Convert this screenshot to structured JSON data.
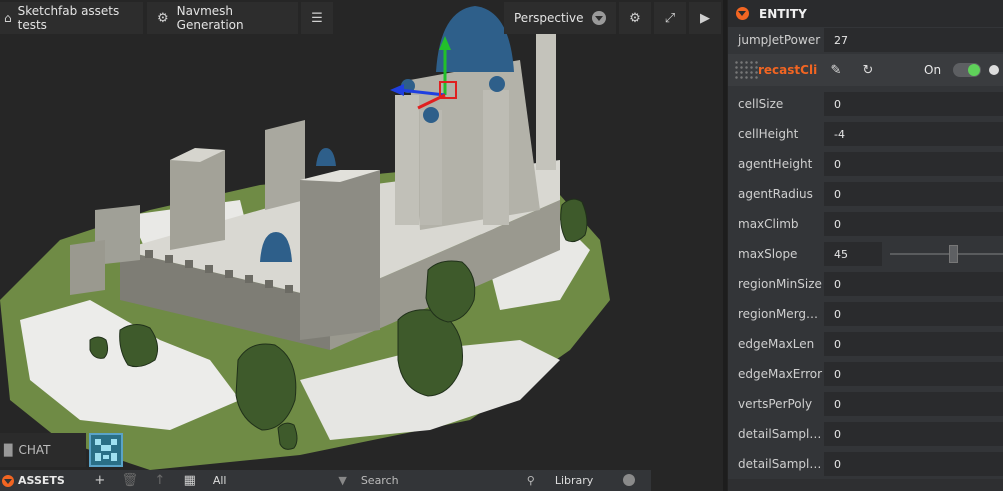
{
  "viewport": {
    "project_name": "Sketchfab assets tests",
    "scene_name": "Navmesh Generation",
    "camera": "Perspective"
  },
  "chat": {
    "label": "CHAT"
  },
  "assets": {
    "title": "ASSETS",
    "filter": "All",
    "search_placeholder": "Search",
    "library": "Library"
  },
  "inspector": {
    "title": "ENTITY",
    "jump": {
      "label": "jumpJetPower",
      "value": "27"
    },
    "script": {
      "name": "recastCli",
      "toggle_label": "On",
      "enabled": true
    },
    "rows": [
      {
        "label": "cellSize",
        "value": "0"
      },
      {
        "label": "cellHeight",
        "value": "-4"
      },
      {
        "label": "agentHeight",
        "value": "0"
      },
      {
        "label": "agentRadius",
        "value": "0"
      },
      {
        "label": "maxClimb",
        "value": "0"
      },
      {
        "label": "maxSlope",
        "value": "45"
      },
      {
        "label": "regionMinSize",
        "value": "0"
      },
      {
        "label": "regionMerge...",
        "value": "0"
      },
      {
        "label": "edgeMaxLen",
        "value": "0"
      },
      {
        "label": "edgeMaxError",
        "value": "0"
      },
      {
        "label": "vertsPerPoly",
        "value": "0"
      },
      {
        "label": "detailSample...",
        "value": "0"
      },
      {
        "label": "detailSample...",
        "value": "0"
      }
    ]
  },
  "colors": {
    "accent": "#f26522",
    "toggle_on": "#5fd15a",
    "viewport_bg": "#262626",
    "panel_bg": "#333538",
    "grass": "#6f8b45",
    "stone": "#8a8a82",
    "dome": "#2e5f8a"
  },
  "icons": {
    "project": "home-icon",
    "scene": "gear-icon",
    "menu": "list-icon",
    "settings": "gear-icon",
    "fullscreen": "fullscreen-icon",
    "play": "play-icon",
    "chat": "chat-icon"
  }
}
